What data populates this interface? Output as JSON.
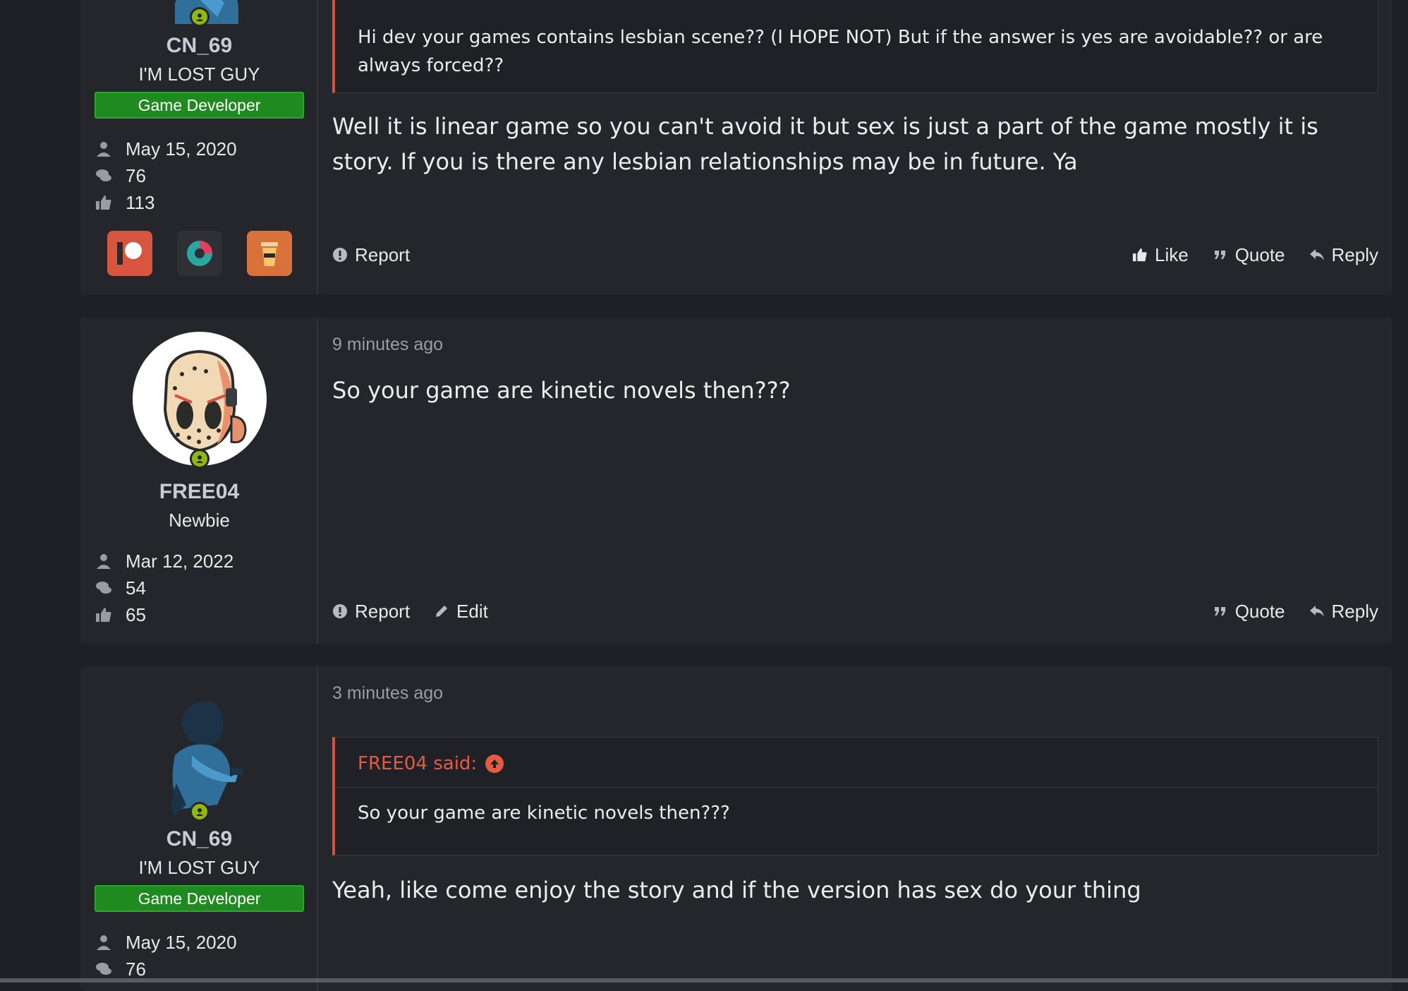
{
  "posts": [
    {
      "user": {
        "name": "CN_69",
        "title": "I'M LOST GUY",
        "banner": "Game Developer",
        "joined": "May 15, 2020",
        "messages": "76",
        "reactions": "113"
      },
      "quote_text": "Hi dev your games contains lesbian scene?? (I HOPE NOT) But if the answer is yes are avoidable?? or are always forced??",
      "message": "Well it is linear game so you can't avoid it but sex is just a part of the game mostly it is story. If you is there any lesbian relationships may be in future. Ya",
      "actions": {
        "report": "Report",
        "like": "Like",
        "quote": "Quote",
        "reply": "Reply"
      }
    },
    {
      "user": {
        "name": "FREE04",
        "title": "Newbie",
        "joined": "Mar 12, 2022",
        "messages": "54",
        "reactions": "65"
      },
      "time": "9 minutes ago",
      "message": "So your game are kinetic novels then???",
      "actions": {
        "report": "Report",
        "edit": "Edit",
        "quote": "Quote",
        "reply": "Reply"
      }
    },
    {
      "user": {
        "name": "CN_69",
        "title": "I'M LOST GUY",
        "banner": "Game Developer",
        "joined": "May 15, 2020",
        "messages": "76"
      },
      "time": "3 minutes ago",
      "quote_author": "FREE04 said:",
      "quote_text": "So your game are kinetic novels then???",
      "message": "Yeah, like come enjoy the story and if the version has sex do your thing"
    }
  ],
  "colors": {
    "accent_quote": "#d9513e",
    "banner_green": "#1f8a1f",
    "online": "#8fb816"
  }
}
